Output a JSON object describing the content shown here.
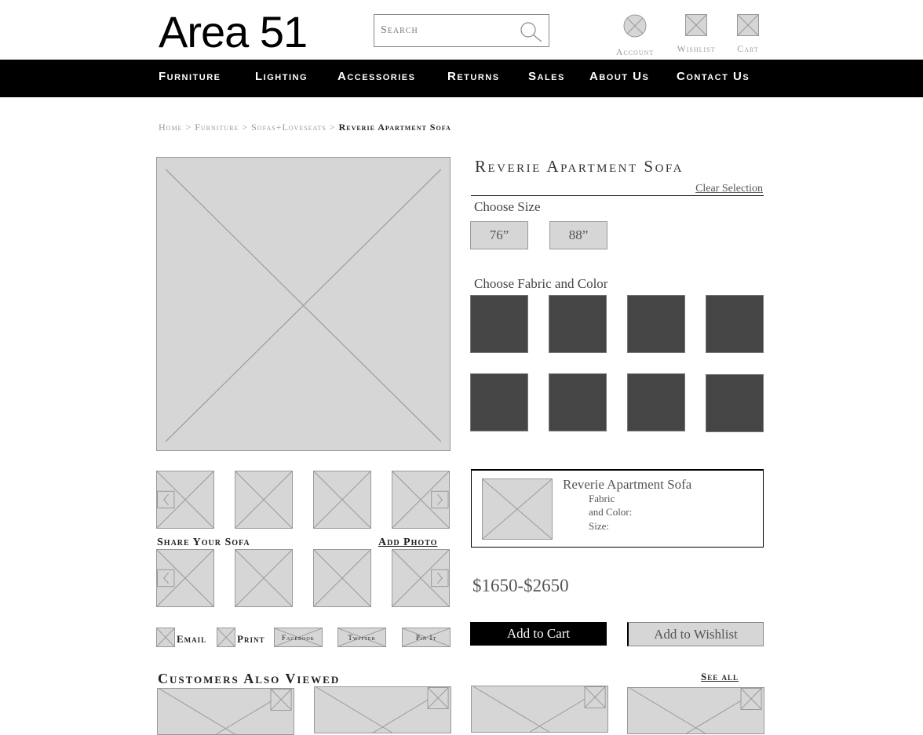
{
  "header": {
    "logo": "Area 51",
    "search_placeholder": "Search",
    "account_label": "Account",
    "wishlist_label": "Wishlist",
    "cart_label": "Cart"
  },
  "nav": [
    "Furniture",
    "Lighting",
    "Accessories",
    "Returns",
    "Sales",
    "About Us",
    "Contact Us"
  ],
  "breadcrumb": {
    "items": [
      "Home",
      "Furniture",
      "Sofas+Loveseats"
    ],
    "separator": ">",
    "current": "Reverie Apartment Sofa"
  },
  "product": {
    "title": "Reverie Apartment Sofa",
    "clear_selection": "Clear Selection",
    "choose_size_label": "Choose Size",
    "sizes": [
      "76”",
      "88”"
    ],
    "choose_fabric_label": "Choose Fabric and Color",
    "swatch_color": "#454545",
    "summary": {
      "name": "Reverie Apartment Sofa",
      "fabric_label": "Fabric",
      "color_label": "and Color:",
      "size_label": "Size:"
    },
    "price": "$1650-$2650",
    "add_to_cart": "Add to Cart",
    "add_to_wishlist": "Add to Wishlist"
  },
  "gallery": {
    "share_heading": "Share Your Sofa",
    "add_photo": "Add Photo"
  },
  "share": {
    "email": "Email",
    "print": "Print",
    "facebook": "Facebook",
    "twitter": "Twitter",
    "pinit": "Pin It"
  },
  "related": {
    "heading": "Customers Also Viewed",
    "see_all": "See all"
  }
}
